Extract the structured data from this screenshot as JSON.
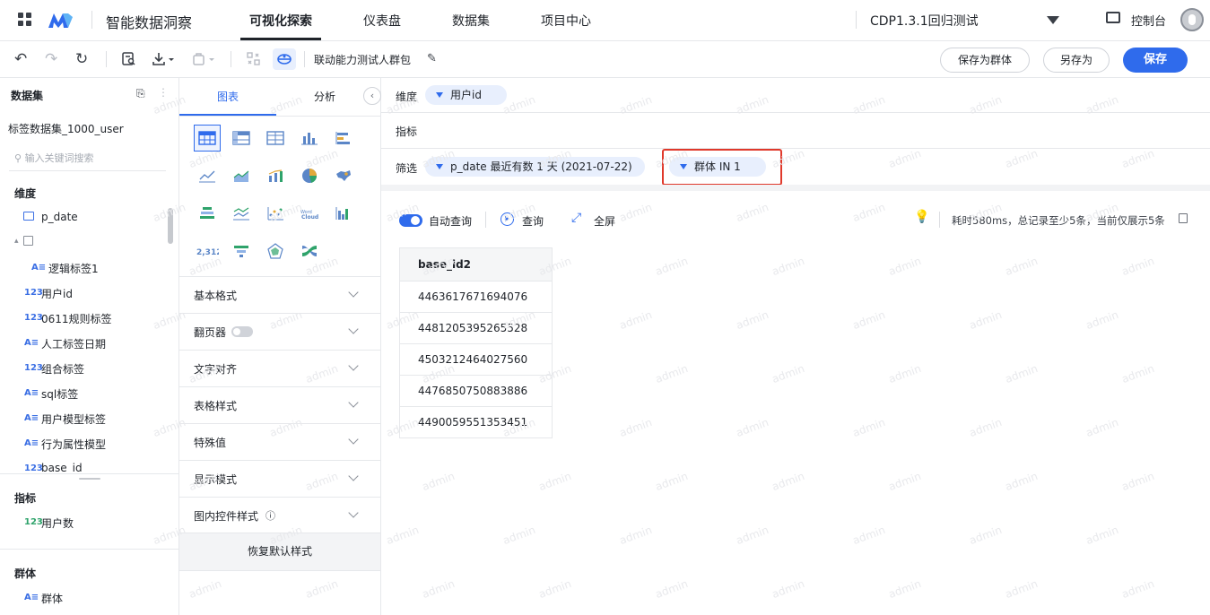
{
  "app": {
    "name": "智能数据洞察"
  },
  "nav": {
    "items": [
      {
        "label": "可视化探索",
        "active": true
      },
      {
        "label": "仪表盘"
      },
      {
        "label": "数据集"
      },
      {
        "label": "项目中心"
      }
    ],
    "project": "CDP1.3.1回归测试",
    "console": "控制台"
  },
  "toolbar": {
    "package_name": "联动能力测试人群包",
    "save_as_group": "保存为群体",
    "save_as": "另存为",
    "save": "保存"
  },
  "left": {
    "title": "数据集",
    "dataset_name": "标签数据集_1000_user",
    "search_placeholder": "输入关键词搜索",
    "dim_title": "维度",
    "dims": [
      {
        "tag": "",
        "label": "p_date",
        "icon": "calendar-icon"
      },
      {
        "tag": "",
        "label": "",
        "icon": "folder-icon"
      },
      {
        "tag": "A≡",
        "label": "逻辑标签1"
      },
      {
        "tag": "123",
        "label": "用户id"
      },
      {
        "tag": "123",
        "label": "0611规则标签"
      },
      {
        "tag": "A≡",
        "label": "人工标签日期"
      },
      {
        "tag": "123",
        "label": "组合标签"
      },
      {
        "tag": "A≡",
        "label": "sql标签"
      },
      {
        "tag": "A≡",
        "label": "用户模型标签"
      },
      {
        "tag": "A≡",
        "label": "行为属性模型"
      },
      {
        "tag": "123",
        "label": "base_id"
      }
    ],
    "metric_title": "指标",
    "metrics": [
      {
        "tag": "123",
        "label": "用户数"
      }
    ],
    "group_title": "群体",
    "groups": [
      {
        "tag": "A≡",
        "label": "群体"
      }
    ]
  },
  "mid": {
    "tabs": [
      "图表",
      "分析"
    ],
    "sections": [
      "基本格式",
      "翻页器",
      "文字对齐",
      "表格样式",
      "特殊值",
      "显示模式",
      "图内控件样式"
    ],
    "reset": "恢复默认样式",
    "chart_number_label": "2,312"
  },
  "query": {
    "dim_label": "维度",
    "dim_pill": "用户id",
    "metric_label": "指标",
    "filter_label": "筛选",
    "filter_pills": [
      "p_date 最近有数 1 天 (2021-07-22)",
      "群体 IN 1"
    ],
    "auto_query": "自动查询",
    "query_btn": "查询",
    "fullscreen": "全屏",
    "status": "耗时580ms，总记录至少5条，当前仅展示5条"
  },
  "result": {
    "column": "base_id2",
    "rows": [
      "4463617671694076",
      "4481205395265528",
      "4503212464027560",
      "4476850750883886",
      "4490059551353451"
    ]
  },
  "watermark": "admin",
  "colors": {
    "accent": "#2f6bec",
    "highlight_box": "#e0392b"
  }
}
